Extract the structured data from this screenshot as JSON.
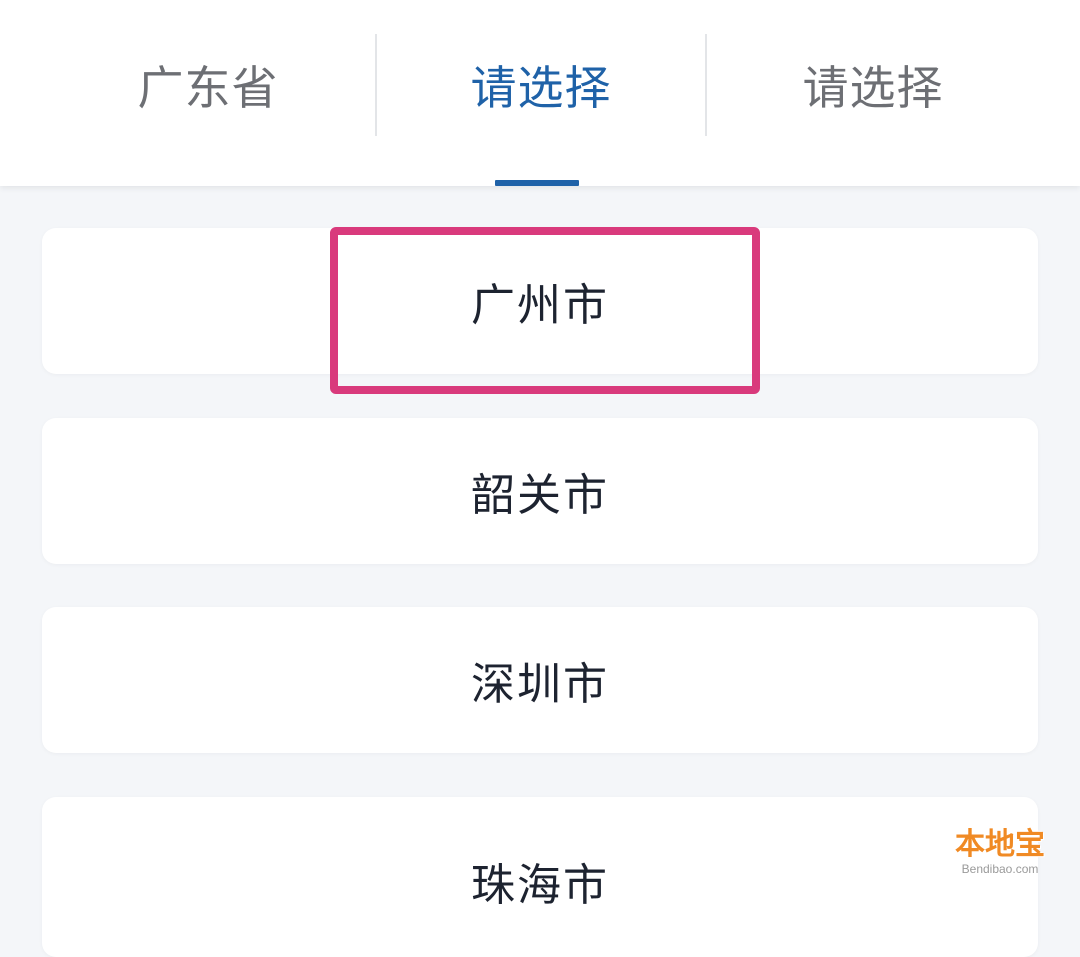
{
  "tabs": {
    "items": [
      {
        "label": "广东省",
        "active": false
      },
      {
        "label": "请选择",
        "active": true
      },
      {
        "label": "请选择",
        "active": false
      }
    ],
    "active_color": "#1f62a8",
    "inactive_color": "#6d6f74"
  },
  "cities": {
    "items": [
      {
        "label": "广州市",
        "highlighted": true
      },
      {
        "label": "韶关市",
        "highlighted": false
      },
      {
        "label": "深圳市",
        "highlighted": false
      },
      {
        "label": "珠海市",
        "highlighted": false
      }
    ]
  },
  "annotation": {
    "highlight_color": "#d93a7c",
    "target": "广州市"
  },
  "watermark": {
    "logo_text": "本地宝",
    "url": "Bendibao.com"
  }
}
